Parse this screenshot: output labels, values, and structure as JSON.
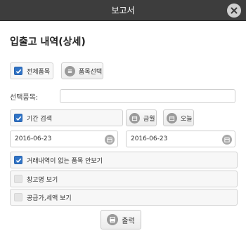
{
  "window": {
    "title": "보고서"
  },
  "heading": "입출고 내역(상세)",
  "all_items": {
    "label": "전체품목",
    "checked": true
  },
  "item_select_button": {
    "label": "품목선택",
    "icon": "list-icon"
  },
  "selected_item": {
    "label": "선택품목:",
    "value": ""
  },
  "period_search": {
    "label": "기간 검색",
    "checked": true
  },
  "this_month_button": {
    "label": "금월",
    "icon": "calendar-icon"
  },
  "today_button": {
    "label": "오늘",
    "icon": "calendar-icon"
  },
  "date_from": {
    "value": "2016-06-23"
  },
  "date_to": {
    "value": "2016-06-23"
  },
  "options": {
    "hide_no_transactions": {
      "label": "거래내역이 없는 품목 안보기",
      "checked": true
    },
    "show_warehouse": {
      "label": "창고명 보기",
      "checked": false
    },
    "show_supply_tax": {
      "label": "공급가,세액 보기",
      "checked": false
    }
  },
  "print_button": {
    "label": "출력",
    "icon": "print-icon"
  },
  "colors": {
    "titlebar": "#3d3d3d",
    "checkbox_on": "#2f73c6"
  }
}
